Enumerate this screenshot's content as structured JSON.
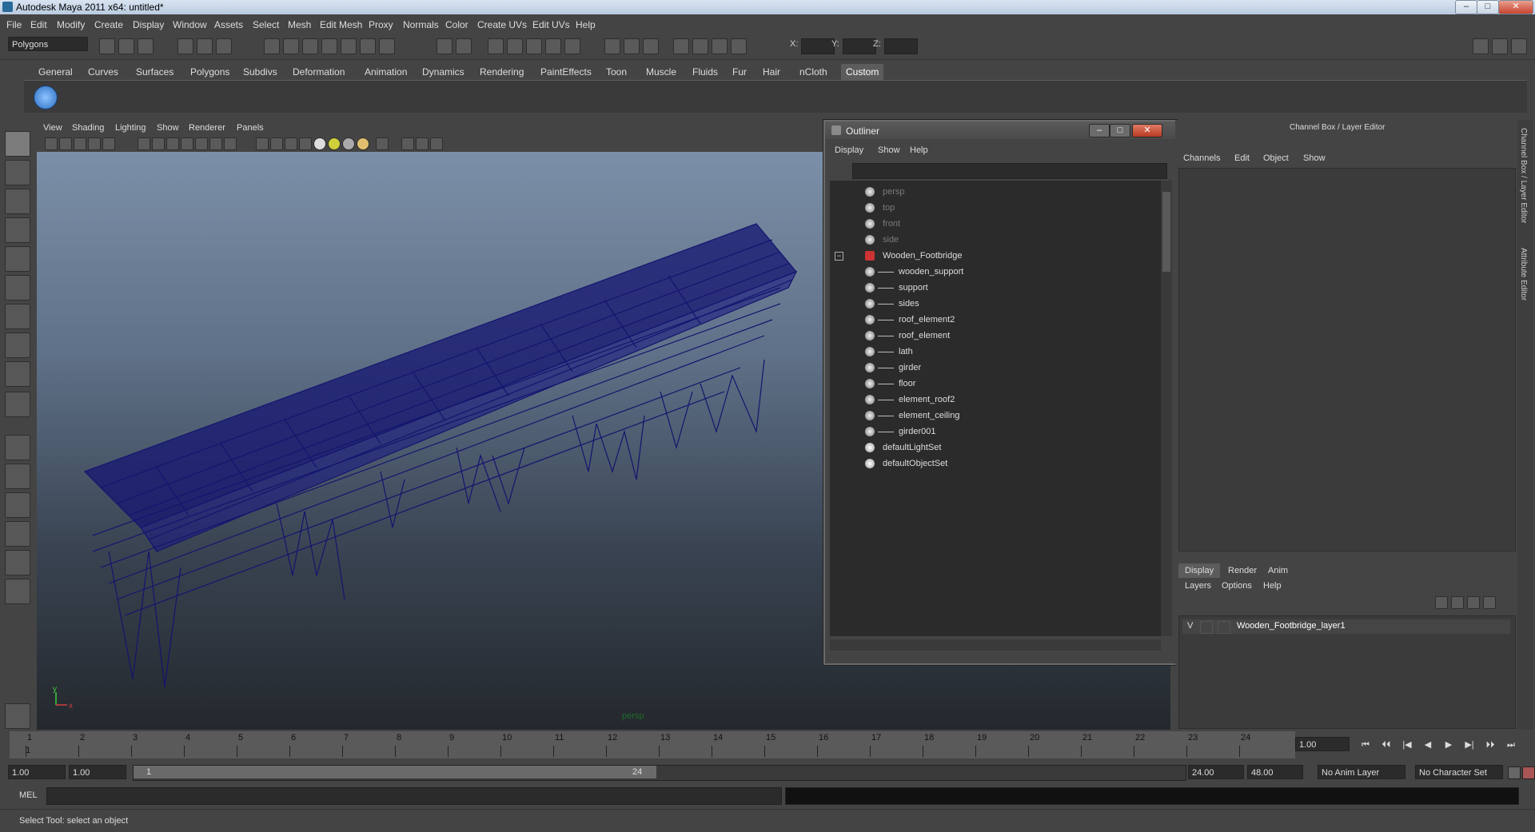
{
  "window": {
    "title": "Autodesk Maya 2011 x64: untitled*",
    "controls": [
      "–",
      "□",
      "✕"
    ]
  },
  "menubar": [
    "File",
    "Edit",
    "Modify",
    "Create",
    "Display",
    "Window",
    "Assets",
    "Select",
    "Mesh",
    "Edit Mesh",
    "Proxy",
    "Normals",
    "Color",
    "Create UVs",
    "Edit UVs",
    "Help"
  ],
  "statusline": {
    "mode": "Polygons",
    "x_label": "X:",
    "y_label": "Y:",
    "z_label": "Z:"
  },
  "shelf": {
    "tabs": [
      "General",
      "Curves",
      "Surfaces",
      "Polygons",
      "Subdivs",
      "Deformation",
      "Animation",
      "Dynamics",
      "Rendering",
      "PaintEffects",
      "Toon",
      "Muscle",
      "Fluids",
      "Fur",
      "Hair",
      "nCloth",
      "Custom"
    ],
    "active_tab": "Custom"
  },
  "viewport": {
    "menu": [
      "View",
      "Shading",
      "Lighting",
      "Show",
      "Renderer",
      "Panels"
    ],
    "camera_label": "persp",
    "axis_x": "x",
    "axis_y": "y",
    "mesh_color": "#14146e"
  },
  "outliner": {
    "title": "Outliner",
    "menu": [
      "Display",
      "Show",
      "Help"
    ],
    "cameras": [
      "persp",
      "top",
      "front",
      "side"
    ],
    "group": "Wooden_Footbridge",
    "children": [
      "wooden_support",
      "support",
      "sides",
      "roof_element2",
      "roof_element",
      "lath",
      "girder",
      "floor",
      "element_roof2",
      "element_ceiling",
      "girder001"
    ],
    "sets": [
      "defaultLightSet",
      "defaultObjectSet"
    ]
  },
  "channel_box": {
    "title": "Channel Box / Layer Editor",
    "menu": [
      "Channels",
      "Edit",
      "Object",
      "Show"
    ],
    "layer_tabs": [
      "Display",
      "Render",
      "Anim"
    ],
    "layer_menu": [
      "Layers",
      "Options",
      "Help"
    ],
    "layer": {
      "visible": "V",
      "name": "Wooden_Footbridge_layer1"
    },
    "side_tabs": [
      "Channel Box / Layer Editor",
      "Attribute Editor"
    ]
  },
  "timeslider": {
    "frames": [
      "1",
      "2",
      "3",
      "4",
      "5",
      "6",
      "7",
      "8",
      "9",
      "10",
      "11",
      "12",
      "13",
      "14",
      "15",
      "16",
      "17",
      "18",
      "19",
      "20",
      "21",
      "22",
      "23",
      "24"
    ],
    "current_marker": "1",
    "current_frame": "1.00"
  },
  "playback": [
    "⏮",
    "⏴⏴",
    "|◀",
    "◀",
    "▶",
    "▶|",
    "⏵⏵",
    "⏭"
  ],
  "range": {
    "start": "1.00",
    "start2": "1.00",
    "inner_start": "1",
    "inner_end": "24",
    "end": "24.00",
    "end2": "48.00",
    "anim_layer": "No Anim Layer",
    "char_set": "No Character Set"
  },
  "cmd": {
    "mel": "MEL"
  },
  "help_line": "Select Tool: select an object"
}
